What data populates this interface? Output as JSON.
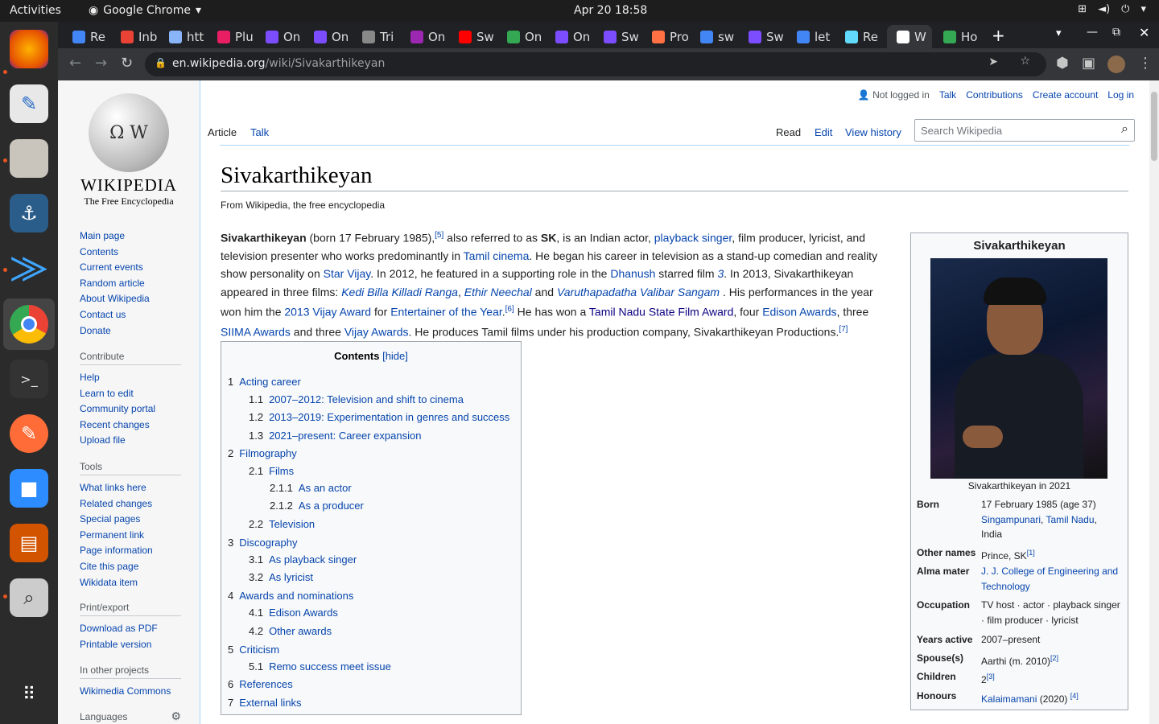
{
  "topbar": {
    "activities": "Activities",
    "app_name": "Google Chrome",
    "clock": "Apr 20  18:58"
  },
  "tabs": [
    {
      "label": "Re",
      "color": "#4285f4"
    },
    {
      "label": "Inb",
      "color": "#ea4335"
    },
    {
      "label": "htt",
      "color": "#8ab4f8"
    },
    {
      "label": "Plu",
      "color": "#e91e63"
    },
    {
      "label": "On",
      "color": "#7c4dff"
    },
    {
      "label": "On",
      "color": "#7c4dff"
    },
    {
      "label": "Tri",
      "color": "#888888"
    },
    {
      "label": "On",
      "color": "#9c27b0"
    },
    {
      "label": "Sw",
      "color": "#ff0000"
    },
    {
      "label": "On",
      "color": "#34a853"
    },
    {
      "label": "On",
      "color": "#7c4dff"
    },
    {
      "label": "Sw",
      "color": "#7c4dff"
    },
    {
      "label": "Pro",
      "color": "#ff7043"
    },
    {
      "label": "sw",
      "color": "#4285f4"
    },
    {
      "label": "Sw",
      "color": "#7c4dff"
    },
    {
      "label": "let",
      "color": "#4285f4"
    },
    {
      "label": "Re",
      "color": "#61dafb"
    },
    {
      "label": "W",
      "color": "#ffffff"
    },
    {
      "label": "Ho",
      "color": "#34a853"
    }
  ],
  "omnibox": {
    "host": "en.wikipedia.org",
    "path": "/wiki/Sivakarthikeyan"
  },
  "personal": {
    "not_logged_in": "Not logged in",
    "talk": "Talk",
    "contributions": "Contributions",
    "create_account": "Create account",
    "log_in": "Log in"
  },
  "logo": {
    "wordmark": "WIKIPEDIA",
    "tagline": "The Free Encyclopedia"
  },
  "nav": {
    "main": [
      "Main page",
      "Contents",
      "Current events",
      "Random article",
      "About Wikipedia",
      "Contact us",
      "Donate"
    ],
    "contribute_title": "Contribute",
    "contribute": [
      "Help",
      "Learn to edit",
      "Community portal",
      "Recent changes",
      "Upload file"
    ],
    "tools_title": "Tools",
    "tools": [
      "What links here",
      "Related changes",
      "Special pages",
      "Permanent link",
      "Page information",
      "Cite this page",
      "Wikidata item"
    ],
    "print_title": "Print/export",
    "print": [
      "Download as PDF",
      "Printable version"
    ],
    "projects_title": "In other projects",
    "projects": [
      "Wikimedia Commons"
    ],
    "languages_title": "Languages"
  },
  "content_tabs": {
    "article": "Article",
    "talk": "Talk",
    "read": "Read",
    "edit": "Edit",
    "history": "View history"
  },
  "search": {
    "placeholder": "Search Wikipedia"
  },
  "article": {
    "title": "Sivakarthikeyan",
    "from": "From Wikipedia, the free encyclopedia"
  },
  "toc": {
    "title": "Contents",
    "hide": "[hide]",
    "items": [
      {
        "num": "1",
        "label": "Acting career"
      },
      {
        "num": "1.1",
        "label": "2007–2012: Television and shift to cinema"
      },
      {
        "num": "1.2",
        "label": "2013–2019: Experimentation in genres and success"
      },
      {
        "num": "1.3",
        "label": "2021–present: Career expansion"
      },
      {
        "num": "2",
        "label": "Filmography"
      },
      {
        "num": "2.1",
        "label": "Films"
      },
      {
        "num": "2.1.1",
        "label": "As an actor"
      },
      {
        "num": "2.1.2",
        "label": "As a producer"
      },
      {
        "num": "2.2",
        "label": "Television"
      },
      {
        "num": "3",
        "label": "Discography"
      },
      {
        "num": "3.1",
        "label": "As playback singer"
      },
      {
        "num": "3.2",
        "label": "As lyricist"
      },
      {
        "num": "4",
        "label": "Awards and nominations"
      },
      {
        "num": "4.1",
        "label": "Edison Awards"
      },
      {
        "num": "4.2",
        "label": "Other awards"
      },
      {
        "num": "5",
        "label": "Criticism"
      },
      {
        "num": "5.1",
        "label": "Remo success meet issue"
      },
      {
        "num": "6",
        "label": "References"
      },
      {
        "num": "7",
        "label": "External links"
      }
    ]
  },
  "infobox": {
    "title": "Sivakarthikeyan",
    "caption": "Sivakarthikeyan in 2021",
    "born_key": "Born",
    "born_1": "17 February 1985 (age 37)",
    "born_place": "Singampunari",
    "born_state": "Tamil Nadu",
    "born_3": "India",
    "other_key": "Other names",
    "other_val": "Prince, SK",
    "other_ref": "[1]",
    "alma_key": "Alma mater",
    "alma_val": "J. J. College of Engineering and Technology",
    "occ_key": "Occupation",
    "occ_val": "TV host · actor · playback singer · film producer · lyricist",
    "years_key": "Years active",
    "years_val": "2007–present",
    "spouse_key": "Spouse(s)",
    "spouse_val": "Aarthi (m. 2010)",
    "spouse_ref": "[2]",
    "children_key": "Children",
    "children_val": "2",
    "children_ref": "[3]",
    "honours_key": "Honours",
    "honours_val": "Kalaimamani",
    "honours_year": " (2020) ",
    "honours_ref": "[4]"
  }
}
